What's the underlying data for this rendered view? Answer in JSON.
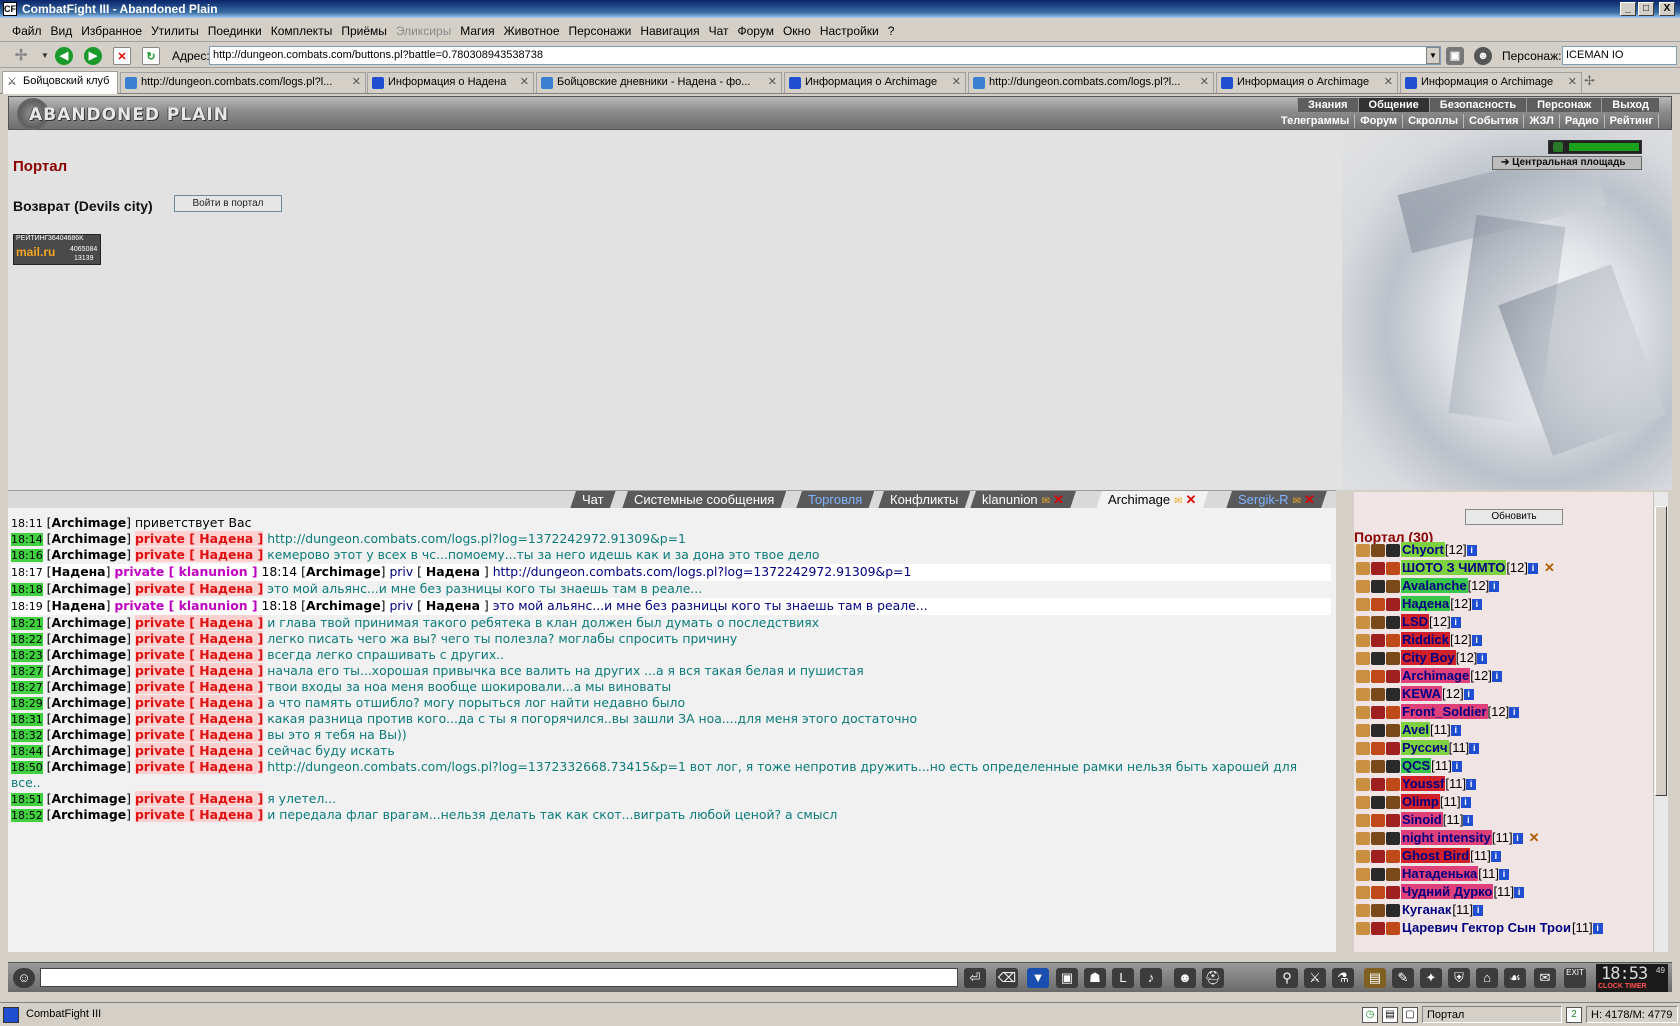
{
  "window": {
    "title": "CombatFight III - Abandoned Plain",
    "minimize": "_",
    "maximize": "□",
    "close": "X"
  },
  "menu": [
    "Файл",
    "Вид",
    "Избранное",
    "Утилиты",
    "Поединки",
    "Комплекты",
    "Приёмы",
    "Эликсиры",
    "Магия",
    "Животное",
    "Персонажи",
    "Навигация",
    "Чат",
    "Форум",
    "Окно",
    "Настройки",
    "?"
  ],
  "address": {
    "label": "Адрес:",
    "url": "http://dungeon.combats.com/buttons.pl?battle=0.780308943538738"
  },
  "persona": {
    "label": "Персонаж:",
    "value": "ICEMAN IO"
  },
  "tabs": [
    {
      "label": "Бойцовский клуб"
    },
    {
      "label": "http://dungeon.combats.com/logs.pl?l..."
    },
    {
      "label": "Информация о Надена"
    },
    {
      "label": "Бойцовские дневники - Надена - фо..."
    },
    {
      "label": "Информация о Archimage"
    },
    {
      "label": "http://dungeon.combats.com/logs.pl?l..."
    },
    {
      "label": "Информация о Archimage"
    },
    {
      "label": "Информация о Archimage"
    }
  ],
  "game": {
    "logo": "ABANDONED PLAIN",
    "nav_top": [
      "Знания",
      "Общение",
      "Безопасность",
      "Персонаж",
      "Выход"
    ],
    "nav_sub": [
      "Телеграммы",
      "Форум",
      "Скроллы",
      "События",
      "ЖЗЛ",
      "Радио",
      "Рейтинг"
    ]
  },
  "main": {
    "title": "Портал",
    "return_label": "Возврат (Devils city)",
    "enter_button": "Войти в портал",
    "rating": {
      "label": "РЕЙТИНГ",
      "count": "36404686K",
      "brand": "mail.ru",
      "n1": "4065084",
      "n2": "13139"
    },
    "central_button": "Центральная площадь"
  },
  "chat_tabs": [
    {
      "label": "Чат"
    },
    {
      "label": "Системные сообщения"
    },
    {
      "label": "Торговля"
    },
    {
      "label": "Конфликты"
    },
    {
      "label": "klanunion"
    },
    {
      "label": "Archimage"
    },
    {
      "label": "Sergik-R"
    }
  ],
  "chat": {
    "private_word": "private",
    "priv_word": "priv",
    "lines": [
      {
        "time": "18:11",
        "who": "Archimage",
        "text": "приветствует Вас"
      },
      {
        "time": "18:14",
        "who": "Archimage",
        "to": "Надена",
        "text": "http://dungeon.combats.com/logs.pl?log=1372242972.91309&p=1"
      },
      {
        "time": "18:16",
        "who": "Archimage",
        "to": "Надена",
        "text": "кемерово этот у всех в чс...помоему...ты за него идешь как и за дона это твое дело"
      },
      {
        "time": "18:17",
        "who": "Надена",
        "to": "klanunion",
        "time2": "18:14",
        "who2": "Archimage",
        "to2": "Надена",
        "text": "http://dungeon.combats.com/logs.pl?log=1372242972.91309&p=1"
      },
      {
        "time": "18:18",
        "who": "Archimage",
        "to": "Надена",
        "text": "это мой альянс...и мне без разницы кого ты знаешь там в реале..."
      },
      {
        "time": "18:19",
        "who": "Надена",
        "to": "klanunion",
        "time2": "18:18",
        "who2": "Archimage",
        "to2": "Надена",
        "text": "это мой альянс...и мне без разницы кого ты знаешь там в реале..."
      },
      {
        "time": "18:21",
        "who": "Archimage",
        "to": "Надена",
        "text": "и глава твой принимая такого ребятека в клан должен был думать о последствиях"
      },
      {
        "time": "18:22",
        "who": "Archimage",
        "to": "Надена",
        "text": "легко писать чего жа вы? чего ты полезла? моглабы спросить причину"
      },
      {
        "time": "18:23",
        "who": "Archimage",
        "to": "Надена",
        "text": "всегда легко спрашивать с других.."
      },
      {
        "time": "18:27",
        "who": "Archimage",
        "to": "Надена",
        "text": "начала его ты...хорошая привычка все валить на других ...а я вся такая белая и пушистая"
      },
      {
        "time": "18:27",
        "who": "Archimage",
        "to": "Надена",
        "text": "твои входы за ноа меня вообще шокировали...а мы виноваты"
      },
      {
        "time": "18:29",
        "who": "Archimage",
        "to": "Надена",
        "text": "а что память отшибло? могу порыться лог найти недавно было"
      },
      {
        "time": "18:31",
        "who": "Archimage",
        "to": "Надена",
        "text": "какая разница против кого...да с ты я погорячился..вы зашли ЗА ноа....для меня этого достаточно"
      },
      {
        "time": "18:32",
        "who": "Archimage",
        "to": "Надена",
        "text": "вы это я тебя на Вы))"
      },
      {
        "time": "18:44",
        "who": "Archimage",
        "to": "Надена",
        "text": "сейчас буду искать"
      },
      {
        "time": "18:50",
        "who": "Archimage",
        "to": "Надена",
        "text": "http://dungeon.combats.com/logs.pl?log=1372332668.73415&p=1 вот лог, я тоже непротив дружить...но есть определенные рамки нельзя быть харошей для",
        "cont": "все.."
      },
      {
        "time": "18:51",
        "who": "Archimage",
        "to": "Надена",
        "text": "я улетел..."
      },
      {
        "time": "18:52",
        "who": "Archimage",
        "to": "Надена",
        "text": "и передала флаг врагам...нельзя делать так как скот...виграть любой ценой? а смысл"
      }
    ]
  },
  "sidebar": {
    "refresh": "Обновить",
    "title": "Портал (30)",
    "players": [
      {
        "name": "Chyort",
        "level": "[12]",
        "color": "#7fd23f"
      },
      {
        "name": "ШОТО З ЧИМТО",
        "level": "[12]",
        "color": "#7fd23f"
      },
      {
        "name": "Avalanche",
        "level": "[12]",
        "color": "#39c44a"
      },
      {
        "name": "Надена",
        "level": "[12]",
        "color": "#39c44a"
      },
      {
        "name": "LSD",
        "level": "[12]",
        "color": "#d0202a"
      },
      {
        "name": "Riddick",
        "level": "[12]",
        "color": "#d0202a"
      },
      {
        "name": "City Boy",
        "level": "[12]",
        "color": "#d0202a"
      },
      {
        "name": "Archimage",
        "level": "[12]",
        "color": "#e0407a"
      },
      {
        "name": "KEWA",
        "level": "[12]",
        "color": "#e0407a"
      },
      {
        "name": "Front_Soldier",
        "level": "[12]",
        "color": "#e0407a"
      },
      {
        "name": "Avel",
        "level": "[11]",
        "color": "#7fd23f"
      },
      {
        "name": "Руссич",
        "level": "[11]",
        "color": "#7fd23f"
      },
      {
        "name": "QCS",
        "level": "[11]",
        "color": "#39c44a"
      },
      {
        "name": "Youssf",
        "level": "[11]",
        "color": "#d0202a"
      },
      {
        "name": "Olimp",
        "level": "[11]",
        "color": "#d0202a"
      },
      {
        "name": "Sinoid",
        "level": "[11]",
        "color": "#e0407a"
      },
      {
        "name": "night intensity",
        "level": "[11]",
        "color": "#e0407a"
      },
      {
        "name": "Ghost Bird",
        "level": "[11]",
        "color": "#d0202a"
      },
      {
        "name": "Натаденька",
        "level": "[11]",
        "color": "#e0407a"
      },
      {
        "name": "Чудний Дурко",
        "level": "[11]",
        "color": "#e0407a"
      },
      {
        "name": "Куганак",
        "level": "[11]",
        "color": ""
      },
      {
        "name": "Царевич Гектор Сын Трои",
        "level": "[11]",
        "color": ""
      }
    ]
  },
  "clock": {
    "time": "18:53",
    "sec": "49",
    "label": "CLOCK TIMER"
  },
  "status": {
    "app": "CombatFight III",
    "location": "Портал",
    "hp": "H: 4178/M: 4779"
  }
}
